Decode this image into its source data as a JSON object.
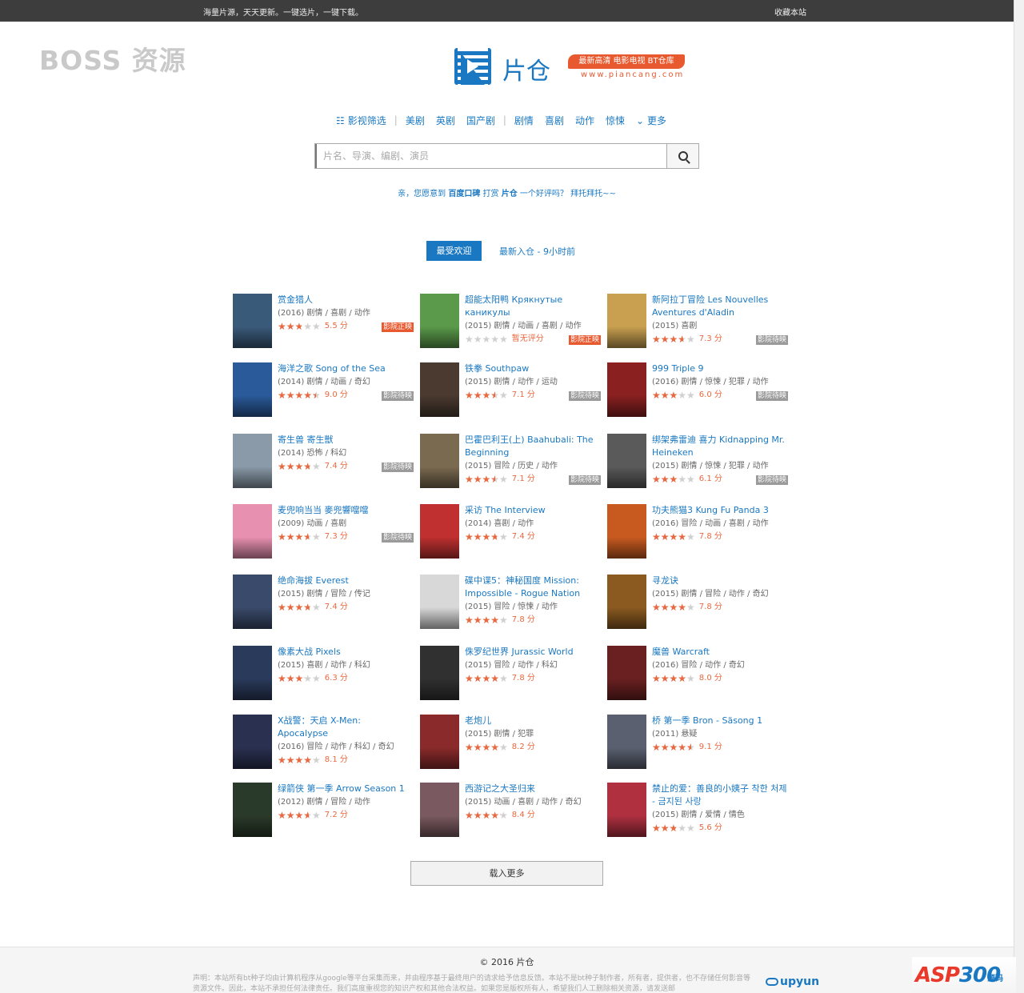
{
  "topbar": {
    "slogan": "海量片源，天天更新。一键选片，一键下载。",
    "favorite": "收藏本站"
  },
  "watermark": {
    "text": "BOSS 资源"
  },
  "logo": {
    "brand": "片仓",
    "ribbon": "最新高清 电影电视 BT仓库",
    "domain": "www.piancang.com",
    "icon": "film-play-icon"
  },
  "nav": {
    "filter": "影视筛选",
    "group1": [
      "美剧",
      "英剧",
      "国产剧"
    ],
    "group2": [
      "剧情",
      "喜剧",
      "动作",
      "惊悚"
    ],
    "more": "更多"
  },
  "search": {
    "placeholder": "片名、导演、编剧、演员",
    "value": ""
  },
  "praise": {
    "a": "亲，您愿意到",
    "b": "百度口碑",
    "c": "打赏",
    "d": "片仓",
    "e": "一个好评吗？ 拜托拜托~~"
  },
  "tabs": {
    "active": "最受欢迎",
    "other": "最新入仓 - 9小时前"
  },
  "colors": {
    "accent": "#1a78c2",
    "star": "#e8683f",
    "badge_red": "#e8592f",
    "badge_gray": "#9a9a9a",
    "topbar": "#3d3d3d"
  },
  "movies": [
    {
      "title": "赏金猎人",
      "meta": "(2016) 剧情 / 喜剧 / 动作",
      "rating": 5.5,
      "score": "5.5 分",
      "badge": "影院正映",
      "badge_type": "red",
      "poster": "#3a5a7a"
    },
    {
      "title": "超能太阳鸭 Крякнутые каникулы",
      "meta": "(2015) 剧情 / 动画 / 喜剧 / 动作",
      "rating": 0,
      "score": "暂无评分",
      "badge": "影院正映",
      "badge_type": "red",
      "poster": "#5a9a4a"
    },
    {
      "title": "新阿拉丁冒险 Les Nouvelles Aventures d'Aladin",
      "meta": "(2015) 喜剧",
      "rating": 7.3,
      "score": "7.3 分",
      "badge": "影院待映",
      "badge_type": "gray",
      "poster": "#c8a050"
    },
    {
      "title": "海洋之歌 Song of the Sea",
      "meta": "(2014) 剧情 / 动画 / 奇幻",
      "rating": 9.0,
      "score": "9.0 分",
      "badge": "影院待映",
      "badge_type": "gray",
      "poster": "#2a5a9a"
    },
    {
      "title": "铁拳 Southpaw",
      "meta": "(2015) 剧情 / 动作 / 运动",
      "rating": 7.1,
      "score": "7.1 分",
      "badge": "影院待映",
      "badge_type": "gray",
      "poster": "#4a3a30"
    },
    {
      "title": "999 Triple 9",
      "meta": "(2016) 剧情 / 惊悚 / 犯罪 / 动作",
      "rating": 6.0,
      "score": "6.0 分",
      "badge": "影院待映",
      "badge_type": "gray",
      "poster": "#8a2020"
    },
    {
      "title": "寄生兽 寄生獣",
      "meta": "(2014) 恐怖 / 科幻",
      "rating": 7.4,
      "score": "7.4 分",
      "badge": "影院待映",
      "badge_type": "gray",
      "poster": "#8a9aa8"
    },
    {
      "title": "巴霍巴利王(上) Baahubali: The Beginning",
      "meta": "(2015) 冒险 / 历史 / 动作",
      "rating": 7.1,
      "score": "7.1 分",
      "badge": "影院待映",
      "badge_type": "gray",
      "poster": "#7a6a50"
    },
    {
      "title": "绑架弗雷迪 喜力 Kidnapping Mr. Heineken",
      "meta": "(2015) 剧情 / 惊悚 / 犯罪 / 动作",
      "rating": 6.1,
      "score": "6.1 分",
      "badge": "影院待映",
      "badge_type": "gray",
      "poster": "#5a5a5a"
    },
    {
      "title": "麦兜响当当 麥兜響噹噹",
      "meta": "(2009) 动画 / 喜剧",
      "rating": 7.3,
      "score": "7.3 分",
      "badge": "影院待映",
      "badge_type": "gray",
      "poster": "#e890b0"
    },
    {
      "title": "采访 The Interview",
      "meta": "(2014) 喜剧 / 动作",
      "rating": 7.4,
      "score": "7.4 分",
      "badge": "",
      "badge_type": "",
      "poster": "#c03030"
    },
    {
      "title": "功夫熊猫3 Kung Fu Panda 3",
      "meta": "(2016) 冒险 / 动画 / 喜剧 / 动作",
      "rating": 7.8,
      "score": "7.8 分",
      "badge": "",
      "badge_type": "",
      "poster": "#c85a20"
    },
    {
      "title": "绝命海拔 Everest",
      "meta": "(2015) 剧情 / 冒险 / 传记",
      "rating": 7.4,
      "score": "7.4 分",
      "badge": "",
      "badge_type": "",
      "poster": "#3a4a6a"
    },
    {
      "title": "碟中谍5：神秘国度 Mission: Impossible - Rogue Nation",
      "meta": "(2015) 冒险 / 惊悚 / 动作",
      "rating": 7.8,
      "score": "7.8 分",
      "badge": "",
      "badge_type": "",
      "poster": "#d8d8d8"
    },
    {
      "title": "寻龙诀",
      "meta": "(2015) 剧情 / 冒险 / 动作 / 奇幻",
      "rating": 7.8,
      "score": "7.8 分",
      "badge": "",
      "badge_type": "",
      "poster": "#8a5a20"
    },
    {
      "title": "像素大战 Pixels",
      "meta": "(2015) 喜剧 / 动作 / 科幻",
      "rating": 6.3,
      "score": "6.3 分",
      "badge": "",
      "badge_type": "",
      "poster": "#2a3a5a"
    },
    {
      "title": "侏罗纪世界 Jurassic World",
      "meta": "(2015) 冒险 / 动作 / 科幻",
      "rating": 7.8,
      "score": "7.8 分",
      "badge": "",
      "badge_type": "",
      "poster": "#303030"
    },
    {
      "title": "魔兽 Warcraft",
      "meta": "(2016) 冒险 / 动作 / 奇幻",
      "rating": 8.0,
      "score": "8.0 分",
      "badge": "",
      "badge_type": "",
      "poster": "#6a2020"
    },
    {
      "title": "X战警：天启 X-Men: Apocalypse",
      "meta": "(2016) 冒险 / 动作 / 科幻 / 奇幻",
      "rating": 8.1,
      "score": "8.1 分",
      "badge": "",
      "badge_type": "",
      "poster": "#2a3050"
    },
    {
      "title": "老炮儿",
      "meta": "(2015) 剧情 / 犯罪",
      "rating": 8.2,
      "score": "8.2 分",
      "badge": "",
      "badge_type": "",
      "poster": "#8a2a2a"
    },
    {
      "title": "桥 第一季 Bron - Säsong 1",
      "meta": "(2011) 悬疑",
      "rating": 9.1,
      "score": "9.1 分",
      "badge": "",
      "badge_type": "",
      "poster": "#5a6070"
    },
    {
      "title": "绿箭侠 第一季 Arrow Season 1",
      "meta": "(2012) 剧情 / 冒险 / 动作",
      "rating": 7.2,
      "score": "7.2 分",
      "badge": "",
      "badge_type": "",
      "poster": "#2a3a2a"
    },
    {
      "title": "西游记之大圣归来",
      "meta": "(2015) 动画 / 喜剧 / 动作 / 奇幻",
      "rating": 8.4,
      "score": "8.4 分",
      "badge": "",
      "badge_type": "",
      "poster": "#7a5a60"
    },
    {
      "title": "禁止的爱：善良的小姨子 착한 처제 - 금지된 사랑",
      "meta": "(2015) 剧情 / 爱情 / 情色",
      "rating": 5.6,
      "score": "5.6 分",
      "badge": "",
      "badge_type": "",
      "poster": "#b03040"
    }
  ],
  "loadmore": "载入更多",
  "footer": {
    "copyright": "© 2016 片仓",
    "disclaimer": "声明：本站所有bt种子均由计算机程序从google等平台采集而来，并由程序基于最终用户的请求给予信息反馈。本站不是bt种子制作者，所有者，提供者，也不存储任何影音等资源文件。因此，本站不承担任何法律责任。我们高度重视您的知识产权和其他合法权益。如果您是版权所有人，希望我们人工删除相关资源，请发送邮",
    "upyun": "upyun",
    "asp300_a": "ASP",
    "asp300_b": "300",
    "asp300_c": "源码"
  }
}
